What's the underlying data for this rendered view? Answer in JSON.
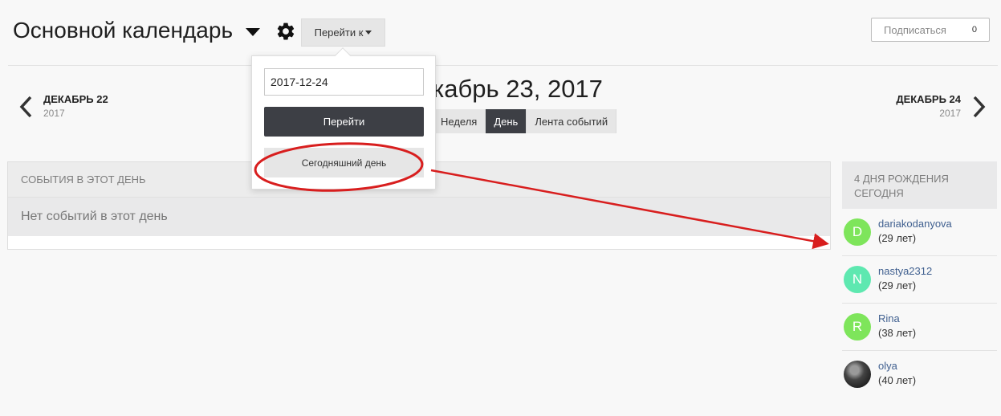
{
  "header": {
    "title": "Основной календарь",
    "goto_label": "Перейти к",
    "subscribe_label": "Подписаться",
    "subscribe_count": "0"
  },
  "day_nav": {
    "prev_label": "ДЕКАБРЬ 22",
    "prev_year": "2017",
    "next_label": "ДЕКАБРЬ 24",
    "next_year": "2017",
    "title": "кабрь 23, 2017"
  },
  "view_tabs": [
    {
      "label": "Неделя",
      "active": false
    },
    {
      "label": "День",
      "active": true
    },
    {
      "label": "Лента событий",
      "active": false
    }
  ],
  "events": {
    "heading": "События в этот день",
    "empty_text": "Нет событий в этот день"
  },
  "birthdays": {
    "heading": "4 дня рождения сегодня",
    "people": [
      {
        "initial": "D",
        "name": "dariakodanyova",
        "age": "(29 лет)",
        "color": "#7ee55b"
      },
      {
        "initial": "N",
        "name": "nastya2312",
        "age": "(29 лет)",
        "color": "#5ee8b0"
      },
      {
        "initial": "R",
        "name": "Rina",
        "age": "(38 лет)",
        "color": "#7ee55b"
      },
      {
        "initial": "",
        "name": "olya",
        "age": "(40 лет)",
        "color": "#555555"
      }
    ]
  },
  "dropdown": {
    "date_value": "2017-12-24",
    "go_label": "Перейти",
    "today_label": "Сегодняшний день"
  },
  "colors": {
    "accent_dark": "#3d3f45",
    "annotation_red": "#d81e1e",
    "link": "#3f5f8f"
  }
}
